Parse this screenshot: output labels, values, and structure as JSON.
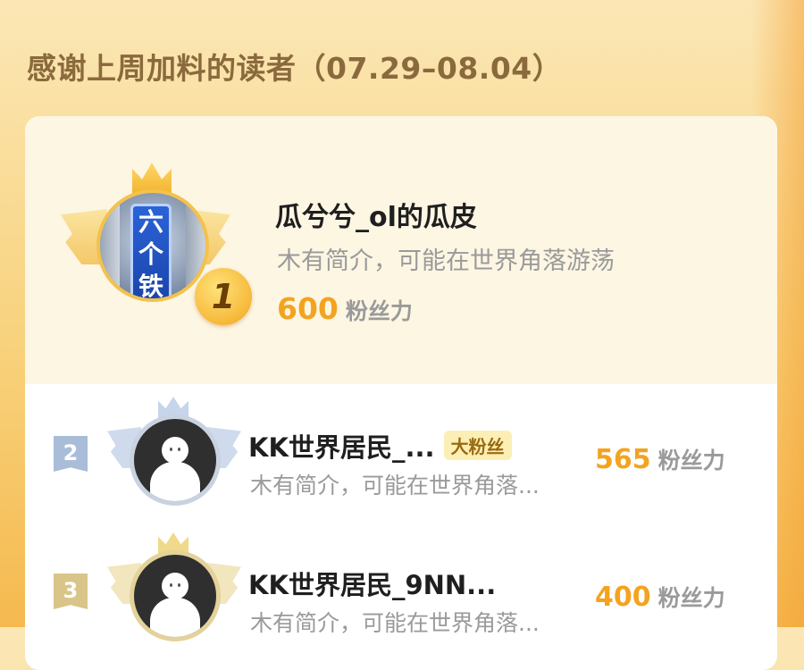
{
  "header": {
    "title": "感谢上周加料的读者（07.29–08.04）"
  },
  "colors": {
    "accent": "#f3a320",
    "gold": "#f3c24e",
    "silver": "#c9d2e0",
    "bronze": "#d9c48a"
  },
  "top_reader": {
    "rank": "1",
    "name": "瓜兮兮_ol的瓜皮",
    "bio": "木有简介，可能在世界角落游荡",
    "score": "600",
    "score_unit": "粉丝力",
    "avatar_text": "六\n个\n铁",
    "icons": [
      "crown-icon",
      "wings-icon",
      "rank-medal-icon"
    ]
  },
  "list": [
    {
      "rank": "2",
      "name": "KK世界居民_...",
      "tag": "大粉丝",
      "bio": "木有简介，可能在世界角落...",
      "score": "565",
      "score_unit": "粉丝力",
      "badge_color": "#a9bcd8",
      "ring_color": "#c9d2e0"
    },
    {
      "rank": "3",
      "name": "KK世界居民_9NN...",
      "tag": "",
      "bio": "木有简介，可能在世界角落...",
      "score": "400",
      "score_unit": "粉丝力",
      "badge_color": "#d9c48a",
      "ring_color": "#e3d29a"
    }
  ]
}
